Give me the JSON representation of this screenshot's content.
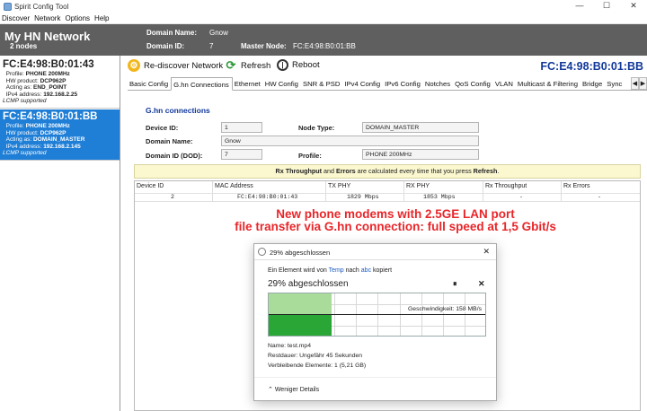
{
  "window": {
    "title": "Spirit Config Tool",
    "controls": [
      "—",
      "☐",
      "✕"
    ]
  },
  "menu": [
    "Discover",
    "Network",
    "Options",
    "Help"
  ],
  "header": {
    "network_name": "My HN Network",
    "node_count": "2 nodes",
    "domain_name_label": "Domain Name:",
    "domain_name_value": "Gnow",
    "domain_id_label": "Domain ID:",
    "domain_id_value": "7",
    "master_node_label": "Master Node:",
    "master_node_value": "FC:E4:98:B0:01:BB"
  },
  "nodes": [
    {
      "mac": "FC:E4:98:B0:01:43",
      "profile_label": "Profile:",
      "profile": "PHONE 200MHz",
      "hw_label": "HW product:",
      "hw": "DCP962P",
      "acting_label": "Acting as:",
      "acting": "END_POINT",
      "ip_label": "IPv4 address:",
      "ip": "192.168.2.25",
      "lcmp": "LCMP supported"
    },
    {
      "mac": "FC:E4:98:B0:01:BB",
      "profile_label": "Profile:",
      "profile": "PHONE 200MHz",
      "hw_label": "HW product:",
      "hw": "DCP962P",
      "acting_label": "Acting as:",
      "acting": "DOMAIN_MASTER",
      "ip_label": "IPv4 address:",
      "ip": "192.168.2.145",
      "lcmp": "LCMP supported"
    }
  ],
  "toolbar": {
    "rediscover_label": "Re-discover Network",
    "refresh_label": "Refresh",
    "reboot_label": "Reboot",
    "current_mac": "FC:E4:98:B0:01:BB"
  },
  "tabs": [
    "Basic Config",
    "G.hn Connections",
    "Ethernet",
    "HW Config",
    "SNR & PSD",
    "IPv4 Config",
    "IPv6 Config",
    "Notches",
    "QoS Config",
    "VLAN",
    "Multicast & Filtering",
    "Bridge",
    "Sync"
  ],
  "tab_scroll": [
    "◀",
    "▶"
  ],
  "panel": {
    "section_title": "G.hn connections",
    "device_id_label": "Device ID:",
    "device_id": "1",
    "node_type_label": "Node Type:",
    "node_type": "DOMAIN_MASTER",
    "domain_name_label": "Domain Name:",
    "domain_name": "Gnow",
    "domain_id_label": "Domain ID (DOD):",
    "domain_id": "7",
    "profile_label": "Profile:",
    "profile": "PHONE 200MHz",
    "notice_bold1": "Rx Throughput",
    "notice_mid": " and ",
    "notice_bold2": "Errors",
    "notice_rest": " are calculated every time that you press ",
    "notice_bold3": "Refresh",
    "notice_end": "."
  },
  "table": {
    "headers": [
      "Device ID",
      "MAC Address",
      "TX PHY",
      "RX PHY",
      "Rx Throughput",
      "Rx Errors"
    ],
    "rows": [
      [
        "2",
        "FC:E4:98:B0:01:43",
        "1829 Mbps",
        "1853 Mbps",
        "-",
        "-"
      ]
    ]
  },
  "overlay": {
    "line1": "New phone modems with 2.5GE LAN port",
    "line2": "file transfer via G.hn connection: full speed at 1,5 Gbit/s"
  },
  "dialog": {
    "title": "29% abgeschlossen",
    "copy_prefix": "Ein Element wird von ",
    "copy_src": "Temp",
    "copy_mid": " nach ",
    "copy_dst": "abc",
    "copy_suffix": " kopiert",
    "progress_text": "29% abgeschlossen",
    "progress": 0.29,
    "speed": "Geschwindigkeit: 158 MB/s",
    "name": "Name: test.mp4",
    "remaining_time": "Restdauer: Ungefähr 45 Sekunden",
    "remaining_items": "Verbleibende Elemente: 1 (5,21 GB)",
    "less_details": "Weniger Details"
  },
  "colors": {
    "selected_node": "#1f7ed6",
    "header_bg": "#5f5f5f",
    "accent_blue": "#12389a",
    "overlay_red": "#e8262a",
    "progress_light": "#a9dc9a",
    "progress_dark": "#2aa636"
  }
}
